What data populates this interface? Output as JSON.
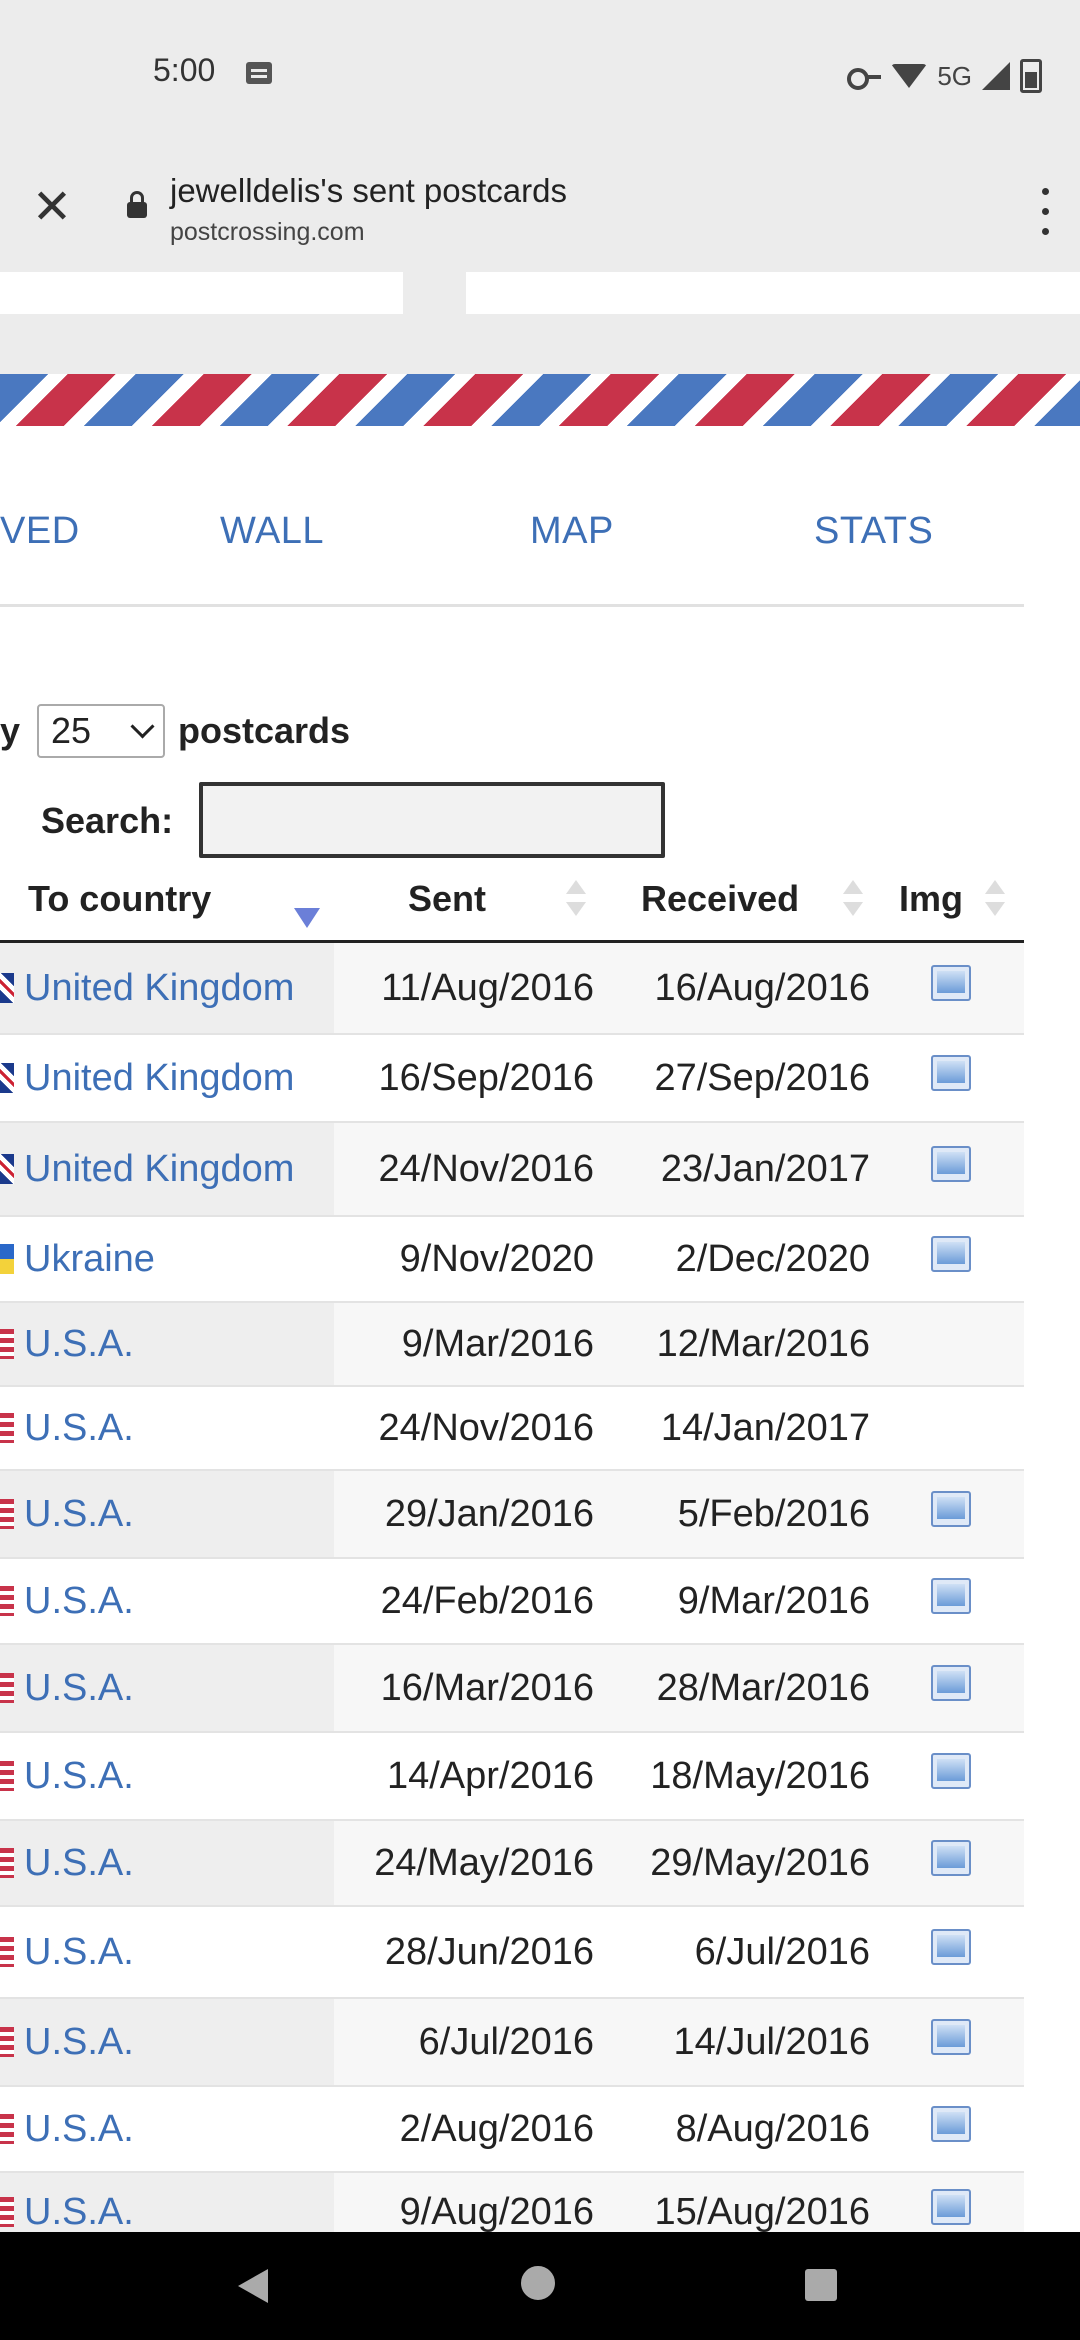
{
  "status_bar": {
    "time": "5:00",
    "network": "5G"
  },
  "browser": {
    "title": "jewelldelis's sent postcards",
    "domain": "postcrossing.com"
  },
  "nav": {
    "items": [
      {
        "label": "VED"
      },
      {
        "label": "WALL"
      },
      {
        "label": "MAP"
      },
      {
        "label": "STATS"
      }
    ]
  },
  "controls": {
    "show_prefix": "y",
    "page_size": "25",
    "postcards_label": "postcards",
    "search_label": "Search:"
  },
  "table": {
    "headers": {
      "country": "To country",
      "sent": "Sent",
      "received": "Received",
      "img": "Img"
    },
    "rows": [
      {
        "flag": "uk",
        "country": "United Kingdom",
        "sent": "11/Aug/2016",
        "received": "16/Aug/2016",
        "img": true
      },
      {
        "flag": "uk",
        "country": "United Kingdom",
        "sent": "16/Sep/2016",
        "received": "27/Sep/2016",
        "img": true
      },
      {
        "flag": "uk",
        "country": "United Kingdom",
        "sent": "24/Nov/2016",
        "received": "23/Jan/2017",
        "img": true
      },
      {
        "flag": "ua",
        "country": "Ukraine",
        "sent": "9/Nov/2020",
        "received": "2/Dec/2020",
        "img": true
      },
      {
        "flag": "us",
        "country": "U.S.A.",
        "sent": "9/Mar/2016",
        "received": "12/Mar/2016",
        "img": false
      },
      {
        "flag": "us",
        "country": "U.S.A.",
        "sent": "24/Nov/2016",
        "received": "14/Jan/2017",
        "img": false
      },
      {
        "flag": "us",
        "country": "U.S.A.",
        "sent": "29/Jan/2016",
        "received": "5/Feb/2016",
        "img": true
      },
      {
        "flag": "us",
        "country": "U.S.A.",
        "sent": "24/Feb/2016",
        "received": "9/Mar/2016",
        "img": true
      },
      {
        "flag": "us",
        "country": "U.S.A.",
        "sent": "16/Mar/2016",
        "received": "28/Mar/2016",
        "img": true
      },
      {
        "flag": "us",
        "country": "U.S.A.",
        "sent": "14/Apr/2016",
        "received": "18/May/2016",
        "img": true
      },
      {
        "flag": "us",
        "country": "U.S.A.",
        "sent": "24/May/2016",
        "received": "29/May/2016",
        "img": true
      },
      {
        "flag": "us",
        "country": "U.S.A.",
        "sent": "28/Jun/2016",
        "received": "6/Jul/2016",
        "img": true
      },
      {
        "flag": "us",
        "country": "U.S.A.",
        "sent": "6/Jul/2016",
        "received": "14/Jul/2016",
        "img": true
      },
      {
        "flag": "us",
        "country": "U.S.A.",
        "sent": "2/Aug/2016",
        "received": "8/Aug/2016",
        "img": true
      },
      {
        "flag": "us",
        "country": "U.S.A.",
        "sent": "9/Aug/2016",
        "received": "15/Aug/2016",
        "img": true
      }
    ]
  }
}
